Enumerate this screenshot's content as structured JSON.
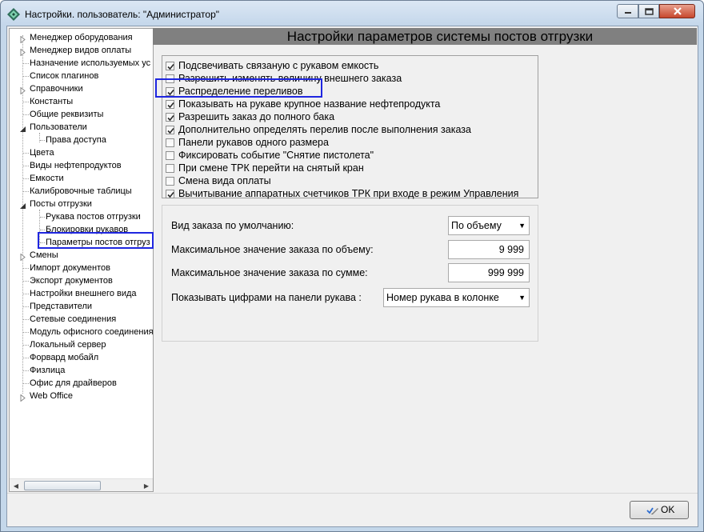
{
  "window": {
    "title": "Настройки. пользователь: \"Администратор\""
  },
  "tree": {
    "items": [
      {
        "label": "Менеджер оборудования",
        "expander": "collapsed",
        "level": 1
      },
      {
        "label": "Менеджер видов оплаты",
        "expander": "collapsed",
        "level": 1
      },
      {
        "label": "Назначение используемых ус",
        "expander": "none",
        "level": 1
      },
      {
        "label": "Список плагинов",
        "expander": "none",
        "level": 1
      },
      {
        "label": "Справочники",
        "expander": "collapsed",
        "level": 1
      },
      {
        "label": "Константы",
        "expander": "none",
        "level": 1
      },
      {
        "label": "Общие реквизиты",
        "expander": "none",
        "level": 1
      },
      {
        "label": "Пользователи",
        "expander": "expanded",
        "level": 1
      },
      {
        "label": "Права доступа",
        "expander": "none",
        "level": 2
      },
      {
        "label": "Цвета",
        "expander": "none",
        "level": 1
      },
      {
        "label": "Виды нефтепродуктов",
        "expander": "none",
        "level": 1
      },
      {
        "label": "Емкости",
        "expander": "none",
        "level": 1
      },
      {
        "label": "Калибровочные таблицы",
        "expander": "none",
        "level": 1
      },
      {
        "label": "Посты отгрузки",
        "expander": "expanded",
        "level": 1
      },
      {
        "label": "Рукава постов отгрузки",
        "expander": "none",
        "level": 2
      },
      {
        "label": "Блокировки рукавов",
        "expander": "none",
        "level": 2
      },
      {
        "label": "Параметры постов отгруз",
        "expander": "none",
        "level": 2,
        "selected": true
      },
      {
        "label": "Смены",
        "expander": "collapsed",
        "level": 1
      },
      {
        "label": "Импорт документов",
        "expander": "none",
        "level": 1
      },
      {
        "label": "Экспорт документов",
        "expander": "none",
        "level": 1
      },
      {
        "label": "Настройки внешнего вида",
        "expander": "none",
        "level": 1
      },
      {
        "label": "Представители",
        "expander": "none",
        "level": 1
      },
      {
        "label": "Сетевые соединения",
        "expander": "none",
        "level": 1
      },
      {
        "label": "Модуль офисного соединения",
        "expander": "none",
        "level": 1
      },
      {
        "label": "Локальный сервер",
        "expander": "none",
        "level": 1
      },
      {
        "label": "Форвард мобайл",
        "expander": "none",
        "level": 1
      },
      {
        "label": "Физлица",
        "expander": "none",
        "level": 1
      },
      {
        "label": "Офис для драйверов",
        "expander": "none",
        "level": 1
      },
      {
        "label": "Web Office",
        "expander": "collapsed",
        "level": 1
      }
    ]
  },
  "panel": {
    "header": "Настройки параметров системы постов отгрузки",
    "checkboxes": [
      {
        "label": "Подсвечивать связаную с рукавом емкость",
        "checked": true
      },
      {
        "label": "Разрешить изменять величину внешнего заказа",
        "checked": false
      },
      {
        "label": "Распределение переливов",
        "checked": true
      },
      {
        "label": "Показывать на рукаве крупное название нефтепродукта",
        "checked": true
      },
      {
        "label": "Разрешить заказ до полного бака",
        "checked": true
      },
      {
        "label": "Дополнительно определять перелив после выполнения заказа",
        "checked": true
      },
      {
        "label": "Панели рукавов одного размера",
        "checked": false
      },
      {
        "label": "Фиксировать событие \"Снятие пистолета\"",
        "checked": false
      },
      {
        "label": "При смене ТРК перейти на снятый кран",
        "checked": false
      },
      {
        "label": "Смена вида оплаты",
        "checked": false
      },
      {
        "label": "Вычитывание аппаратных счетчиков ТРК при входе в режим Управления",
        "checked": true
      }
    ],
    "order_type": {
      "label": "Вид заказа по умолчанию:",
      "value": "По объему"
    },
    "max_volume": {
      "label": "Максимальное значение заказа по объему:",
      "value": "9 999"
    },
    "max_sum": {
      "label": "Максимальное значение заказа по сумме:",
      "value": "999 999"
    },
    "digits_display": {
      "label": "Показывать цифрами на панели рукава :",
      "value": "Номер рукава в колонке"
    }
  },
  "buttons": {
    "ok": "OK"
  },
  "colors": {
    "highlight": "#1f26e0",
    "header_bg": "#808080",
    "titlebar": "#c4d7ea"
  }
}
